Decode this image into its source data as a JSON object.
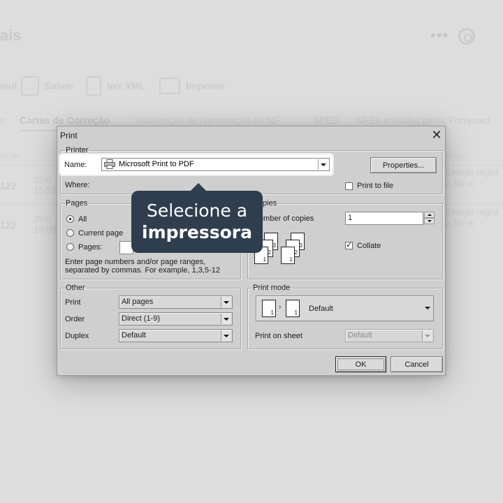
{
  "background": {
    "page_title": "ais",
    "toolbar": {
      "email_label": "nail",
      "save_label": "Salvar",
      "xml_label": "Ver XML",
      "print_label": "Imprimir"
    },
    "tabs": [
      "o",
      "Cartas de Correção",
      "Inutilização de Numeração de NF",
      "SPED",
      "NFEs emitidas pelos Forneced"
    ],
    "columns": {
      "left": "m. NF",
      "right": "Motivo"
    },
    "rows": [
      {
        "number": "122",
        "date": "25/0",
        "time": "15:20",
        "reason_line1": "Evento regist",
        "reason_line2": "a NF-e"
      },
      {
        "number": "122",
        "date": "25/0",
        "time": "15:06",
        "reason_line1": "Evento regist",
        "reason_line2": "a NF-e"
      }
    ]
  },
  "dialog": {
    "title": "Print",
    "close_symbol": "✕",
    "printer": {
      "group_label": "Printer",
      "name_label": "Name:",
      "name_value": "Microsoft Print to PDF",
      "where_label": "Where:",
      "properties_button": "Properties...",
      "print_to_file_label": "Print to file",
      "print_to_file_checked": false
    },
    "pages": {
      "group_label": "Pages",
      "options": [
        "All",
        "Current page",
        "Pages:"
      ],
      "selected": "All",
      "hint_line1": "Enter page numbers and/or page ranges,",
      "hint_line2": "separated by commas. For example, 1,3,5-12"
    },
    "copies": {
      "group_label": "Copies",
      "number_label": "Number of copies",
      "number_value": "1",
      "collate_label": "Collate",
      "collate_checked": true
    },
    "other": {
      "group_label": "Other",
      "print_label": "Print",
      "print_value": "All pages",
      "order_label": "Order",
      "order_value": "Direct (1-9)",
      "duplex_label": "Duplex",
      "duplex_value": "Default"
    },
    "print_mode": {
      "group_label": "Print mode",
      "mode_value": "Default",
      "sheet_label": "Print on sheet",
      "sheet_value": "Default"
    },
    "ok_button": "OK",
    "cancel_button": "Cancel"
  },
  "tooltip": {
    "line1": "Selecione a",
    "line2": "impressora"
  }
}
